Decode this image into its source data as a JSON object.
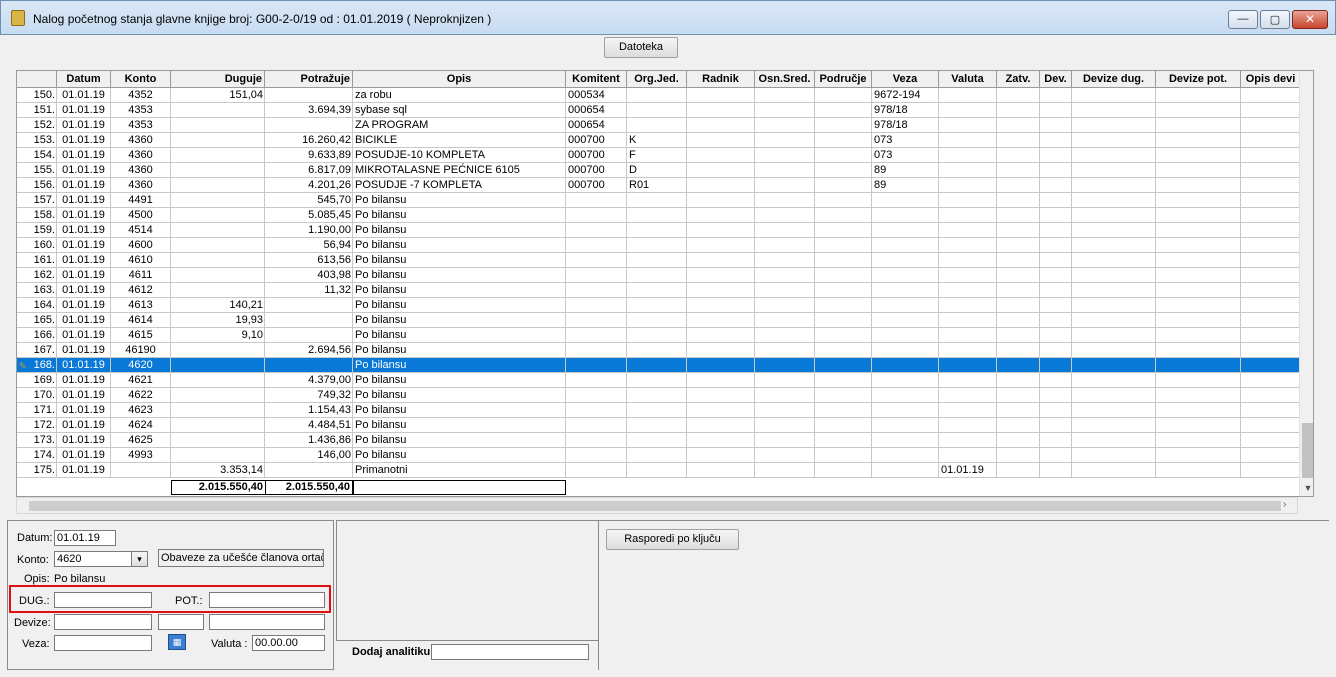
{
  "window": {
    "title": "Nalog početnog stanja glavne knjige broj: G00-2-0/19  od : 01.01.2019 ( Neproknjizen )",
    "min_glyph": "—",
    "max_glyph": "▢",
    "close_glyph": "✕"
  },
  "toolbar": {
    "datoteka_label": "Datoteka"
  },
  "grid": {
    "columns": [
      "",
      "Datum",
      "Konto",
      "Duguje",
      "Potražuje",
      "Opis",
      "Komitent",
      "Org.Jed.",
      "Radnik",
      "Osn.Sred.",
      "Područje",
      "Veza",
      "Valuta",
      "Zatv.",
      "Dev.",
      "Devize dug.",
      "Devize pot.",
      "Opis devi"
    ],
    "rows": [
      {
        "n": "150.",
        "datum": "01.01.19",
        "konto": "4352",
        "duguje": "151,04",
        "potrazuje": "",
        "opis": "za robu",
        "komitent": "000534",
        "org": "",
        "veza": "9672-194",
        "valuta": ""
      },
      {
        "n": "151.",
        "datum": "01.01.19",
        "konto": "4353",
        "duguje": "",
        "potrazuje": "3.694,39",
        "opis": "sybase sql",
        "komitent": "000654",
        "org": "",
        "veza": "978/18",
        "valuta": ""
      },
      {
        "n": "152.",
        "datum": "01.01.19",
        "konto": "4353",
        "duguje": "",
        "potrazuje": "",
        "opis": "ZA PROGRAM",
        "komitent": "000654",
        "org": "",
        "veza": "978/18",
        "valuta": ""
      },
      {
        "n": "153.",
        "datum": "01.01.19",
        "konto": "4360",
        "duguje": "",
        "potrazuje": "16.260,42",
        "opis": "BICIKLE",
        "komitent": "000700",
        "org": "K",
        "veza": "073",
        "valuta": ""
      },
      {
        "n": "154.",
        "datum": "01.01.19",
        "konto": "4360",
        "duguje": "",
        "potrazuje": "9.633,89",
        "opis": "POSUDJE-10 KOMPLETA",
        "komitent": "000700",
        "org": "F",
        "veza": "073",
        "valuta": ""
      },
      {
        "n": "155.",
        "datum": "01.01.19",
        "konto": "4360",
        "duguje": "",
        "potrazuje": "6.817,09",
        "opis": "MIKROTALASNE PEĆNICE 6105",
        "komitent": "000700",
        "org": "D",
        "veza": "89",
        "valuta": ""
      },
      {
        "n": "156.",
        "datum": "01.01.19",
        "konto": "4360",
        "duguje": "",
        "potrazuje": "4.201,26",
        "opis": "POSUDJE -7 KOMPLETA",
        "komitent": "000700",
        "org": "R01",
        "veza": "89",
        "valuta": ""
      },
      {
        "n": "157.",
        "datum": "01.01.19",
        "konto": "4491",
        "duguje": "",
        "potrazuje": "545,70",
        "opis": "Po bilansu",
        "komitent": "",
        "org": "",
        "veza": "",
        "valuta": ""
      },
      {
        "n": "158.",
        "datum": "01.01.19",
        "konto": "4500",
        "duguje": "",
        "potrazuje": "5.085,45",
        "opis": "Po bilansu",
        "komitent": "",
        "org": "",
        "veza": "",
        "valuta": ""
      },
      {
        "n": "159.",
        "datum": "01.01.19",
        "konto": "4514",
        "duguje": "",
        "potrazuje": "1.190,00",
        "opis": "Po bilansu",
        "komitent": "",
        "org": "",
        "veza": "",
        "valuta": ""
      },
      {
        "n": "160.",
        "datum": "01.01.19",
        "konto": "4600",
        "duguje": "",
        "potrazuje": "56,94",
        "opis": "Po bilansu",
        "komitent": "",
        "org": "",
        "veza": "",
        "valuta": ""
      },
      {
        "n": "161.",
        "datum": "01.01.19",
        "konto": "4610",
        "duguje": "",
        "potrazuje": "613,56",
        "opis": "Po bilansu",
        "komitent": "",
        "org": "",
        "veza": "",
        "valuta": ""
      },
      {
        "n": "162.",
        "datum": "01.01.19",
        "konto": "4611",
        "duguje": "",
        "potrazuje": "403,98",
        "opis": "Po bilansu",
        "komitent": "",
        "org": "",
        "veza": "",
        "valuta": ""
      },
      {
        "n": "163.",
        "datum": "01.01.19",
        "konto": "4612",
        "duguje": "",
        "potrazuje": "11,32",
        "opis": "Po bilansu",
        "komitent": "",
        "org": "",
        "veza": "",
        "valuta": ""
      },
      {
        "n": "164.",
        "datum": "01.01.19",
        "konto": "4613",
        "duguje": "140,21",
        "potrazuje": "",
        "opis": "Po bilansu",
        "komitent": "",
        "org": "",
        "veza": "",
        "valuta": ""
      },
      {
        "n": "165.",
        "datum": "01.01.19",
        "konto": "4614",
        "duguje": "19,93",
        "potrazuje": "",
        "opis": "Po bilansu",
        "komitent": "",
        "org": "",
        "veza": "",
        "valuta": ""
      },
      {
        "n": "166.",
        "datum": "01.01.19",
        "konto": "4615",
        "duguje": "9,10",
        "potrazuje": "",
        "opis": "Po bilansu",
        "komitent": "",
        "org": "",
        "veza": "",
        "valuta": ""
      },
      {
        "n": "167.",
        "datum": "01.01.19",
        "konto": "46190",
        "duguje": "",
        "potrazuje": "2.694,56",
        "opis": "Po bilansu",
        "komitent": "",
        "org": "",
        "veza": "",
        "valuta": ""
      },
      {
        "n": "168.",
        "datum": "01.01.19",
        "konto": "4620",
        "duguje": "",
        "potrazuje": "",
        "opis": "Po bilansu",
        "komitent": "",
        "org": "",
        "veza": "",
        "valuta": "",
        "selected": true
      },
      {
        "n": "169.",
        "datum": "01.01.19",
        "konto": "4621",
        "duguje": "",
        "potrazuje": "4.379,00",
        "opis": "Po bilansu",
        "komitent": "",
        "org": "",
        "veza": "",
        "valuta": ""
      },
      {
        "n": "170.",
        "datum": "01.01.19",
        "konto": "4622",
        "duguje": "",
        "potrazuje": "749,32",
        "opis": "Po bilansu",
        "komitent": "",
        "org": "",
        "veza": "",
        "valuta": ""
      },
      {
        "n": "171.",
        "datum": "01.01.19",
        "konto": "4623",
        "duguje": "",
        "potrazuje": "1.154,43",
        "opis": "Po bilansu",
        "komitent": "",
        "org": "",
        "veza": "",
        "valuta": ""
      },
      {
        "n": "172.",
        "datum": "01.01.19",
        "konto": "4624",
        "duguje": "",
        "potrazuje": "4.484,51",
        "opis": "Po bilansu",
        "komitent": "",
        "org": "",
        "veza": "",
        "valuta": ""
      },
      {
        "n": "173.",
        "datum": "01.01.19",
        "konto": "4625",
        "duguje": "",
        "potrazuje": "1.436,86",
        "opis": "Po bilansu",
        "komitent": "",
        "org": "",
        "veza": "",
        "valuta": ""
      },
      {
        "n": "174.",
        "datum": "01.01.19",
        "konto": "4993",
        "duguje": "",
        "potrazuje": "146,00",
        "opis": "Po bilansu",
        "komitent": "",
        "org": "",
        "veza": "",
        "valuta": ""
      },
      {
        "n": "175.",
        "datum": "01.01.19",
        "konto": "",
        "duguje": "3.353,14",
        "potrazuje": "",
        "opis": "Primanotni",
        "komitent": "",
        "org": "",
        "veza": "",
        "valuta": "01.01.19"
      }
    ],
    "totals": {
      "duguje": "2.015.550,40",
      "potrazuje": "2.015.550,40"
    }
  },
  "form": {
    "datum_label": "Datum:",
    "datum_value": "01.01.19",
    "konto_label": "Konto:",
    "konto_value": "4620",
    "konto_desc": "Obaveze za učešće članova ortač",
    "opis_label": "Opis:",
    "opis_value": "Po bilansu",
    "dug_label": "DUG.:",
    "dug_value": "",
    "pot_label": "POT.:",
    "pot_value": "",
    "devize_label": "Devize:",
    "veza_label": "Veza:",
    "veza_value": "",
    "valuta_label": "Valuta :",
    "valuta_value": "00.00.00"
  },
  "middle": {
    "dodaj_label": "Dodaj analitiku:",
    "dodaj_value": ""
  },
  "right": {
    "rasporedi_label": "Rasporedi po ključu"
  },
  "colors": {
    "selection": "#0a78d7",
    "highlight": "#e01010"
  }
}
